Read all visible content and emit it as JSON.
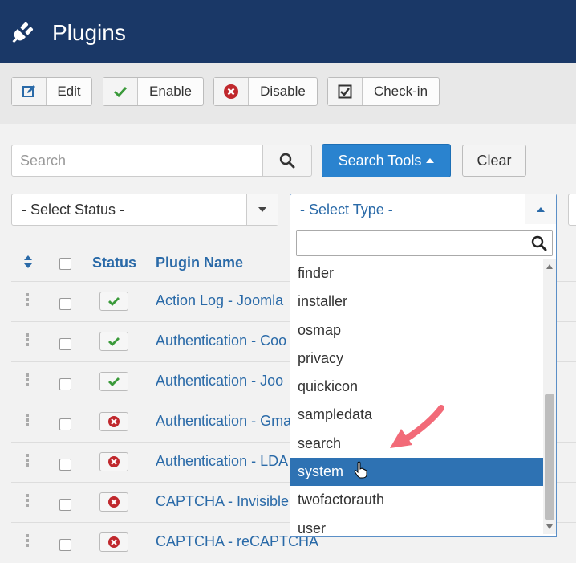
{
  "header": {
    "title": "Plugins",
    "icon": "plug-icon"
  },
  "toolbar": {
    "edit_label": "Edit",
    "enable_label": "Enable",
    "disable_label": "Disable",
    "checkin_label": "Check-in"
  },
  "search": {
    "placeholder": "Search",
    "tools_label": "Search Tools",
    "clear_label": "Clear"
  },
  "filters": {
    "status_selected": "- Select Status -",
    "type_selected": "- Select Type -"
  },
  "table": {
    "headers": {
      "status": "Status",
      "name": "Plugin Name"
    },
    "rows": [
      {
        "status": "enabled",
        "name": "Action Log - Joomla"
      },
      {
        "status": "enabled",
        "name": "Authentication - Coo"
      },
      {
        "status": "enabled",
        "name": "Authentication - Joo"
      },
      {
        "status": "disabled",
        "name": "Authentication - Gma"
      },
      {
        "status": "disabled",
        "name": "Authentication - LDA"
      },
      {
        "status": "disabled",
        "name": "CAPTCHA - Invisible"
      },
      {
        "status": "disabled",
        "name": "CAPTCHA - reCAPTCHA"
      }
    ]
  },
  "type_dropdown": {
    "search_value": "",
    "options": [
      "finder",
      "installer",
      "osmap",
      "privacy",
      "quickicon",
      "sampledata",
      "search",
      "system",
      "twofactorauth",
      "user"
    ],
    "highlighted": "system"
  },
  "colors": {
    "header_bg": "#1a3867",
    "primary": "#2a83cf",
    "link": "#2a6aa8",
    "highlight": "#2e72b3",
    "annotation_arrow": "#f26a78"
  }
}
